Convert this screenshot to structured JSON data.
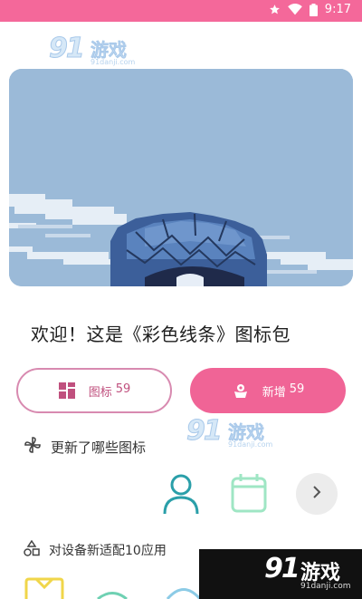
{
  "status_bar": {
    "time": "9:17",
    "icons": [
      "star-icon",
      "wifi-icon",
      "battery-icon"
    ],
    "color": "#f4689a"
  },
  "watermark": {
    "brand_number": "91",
    "brand_name": "游戏",
    "domain": "91danji.com"
  },
  "hero": {
    "image_name": "pixel-sky-balloon-illustration"
  },
  "welcome": {
    "text": "欢迎！这是《彩色线条》图标包"
  },
  "buttons": {
    "icons_label": "图标",
    "icons_count": "59",
    "new_label": "新增",
    "new_count": "59",
    "accent": "#f06496"
  },
  "sections": {
    "updated_title": "更新了哪些图标",
    "adapted_title": "对设备新适配10应用"
  },
  "preview_icons": [
    "person-outline-icon",
    "calendar-outline-icon"
  ],
  "next_icon": "chevron-right-icon"
}
